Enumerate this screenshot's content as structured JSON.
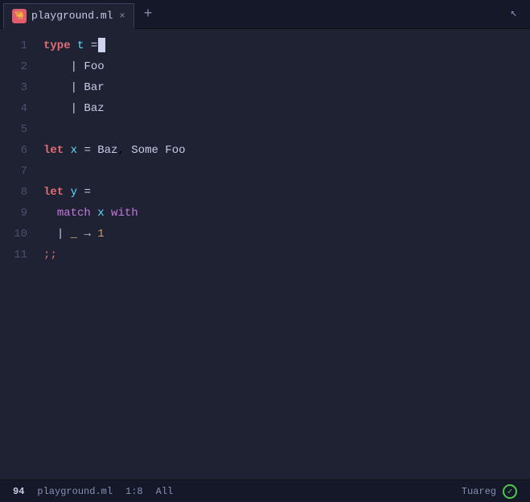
{
  "tab": {
    "title": "playground.ml",
    "close_label": "×",
    "add_label": "+",
    "icon_text": "🐫"
  },
  "editor": {
    "lines": [
      {
        "num": "1",
        "tokens": [
          {
            "t": "kw",
            "v": "type"
          },
          {
            "t": "plain",
            "v": " "
          },
          {
            "t": "var",
            "v": "t"
          },
          {
            "t": "plain",
            "v": " "
          },
          {
            "t": "op",
            "v": "="
          },
          {
            "t": "cursor",
            "v": ""
          }
        ]
      },
      {
        "num": "2",
        "tokens": [
          {
            "t": "plain",
            "v": "    "
          },
          {
            "t": "op",
            "v": "|"
          },
          {
            "t": "plain",
            "v": " "
          },
          {
            "t": "ctor",
            "v": "Foo"
          }
        ]
      },
      {
        "num": "3",
        "tokens": [
          {
            "t": "plain",
            "v": "    "
          },
          {
            "t": "op",
            "v": "|"
          },
          {
            "t": "plain",
            "v": " "
          },
          {
            "t": "ctor",
            "v": "Bar"
          }
        ]
      },
      {
        "num": "4",
        "tokens": [
          {
            "t": "plain",
            "v": "    "
          },
          {
            "t": "op",
            "v": "|"
          },
          {
            "t": "plain",
            "v": " "
          },
          {
            "t": "ctor",
            "v": "Baz"
          }
        ]
      },
      {
        "num": "5",
        "tokens": []
      },
      {
        "num": "6",
        "tokens": [
          {
            "t": "kw",
            "v": "let"
          },
          {
            "t": "plain",
            "v": " "
          },
          {
            "t": "var",
            "v": "x"
          },
          {
            "t": "plain",
            "v": " "
          },
          {
            "t": "op",
            "v": "="
          },
          {
            "t": "plain",
            "v": " "
          },
          {
            "t": "ctor",
            "v": "Baz"
          },
          {
            "t": "plain",
            "v": ", "
          },
          {
            "t": "ctor",
            "v": "Some"
          },
          {
            "t": "plain",
            "v": " "
          },
          {
            "t": "ctor",
            "v": "Foo"
          }
        ]
      },
      {
        "num": "7",
        "tokens": []
      },
      {
        "num": "8",
        "tokens": [
          {
            "t": "kw",
            "v": "let"
          },
          {
            "t": "plain",
            "v": " "
          },
          {
            "t": "var",
            "v": "y"
          },
          {
            "t": "plain",
            "v": " "
          },
          {
            "t": "op",
            "v": "="
          }
        ]
      },
      {
        "num": "9",
        "tokens": [
          {
            "t": "plain",
            "v": "  "
          },
          {
            "t": "match",
            "v": "match"
          },
          {
            "t": "plain",
            "v": " "
          },
          {
            "t": "var",
            "v": "x"
          },
          {
            "t": "plain",
            "v": " "
          },
          {
            "t": "with",
            "v": "with"
          }
        ]
      },
      {
        "num": "10",
        "tokens": [
          {
            "t": "plain",
            "v": "  "
          },
          {
            "t": "op",
            "v": "|"
          },
          {
            "t": "plain",
            "v": " "
          },
          {
            "t": "wild",
            "v": "_"
          },
          {
            "t": "plain",
            "v": " "
          },
          {
            "t": "arrow",
            "v": "→"
          },
          {
            "t": "plain",
            "v": " "
          },
          {
            "t": "num",
            "v": "1"
          }
        ]
      },
      {
        "num": "11",
        "tokens": [
          {
            "t": "semi",
            "v": ";;"
          }
        ]
      }
    ]
  },
  "status_bar": {
    "line_col_number": "94",
    "filename": "playground.ml",
    "position": "1:8",
    "all_label": "All",
    "mode": "Tuareg",
    "check_icon": "✓"
  },
  "cursor_icon": "↖"
}
